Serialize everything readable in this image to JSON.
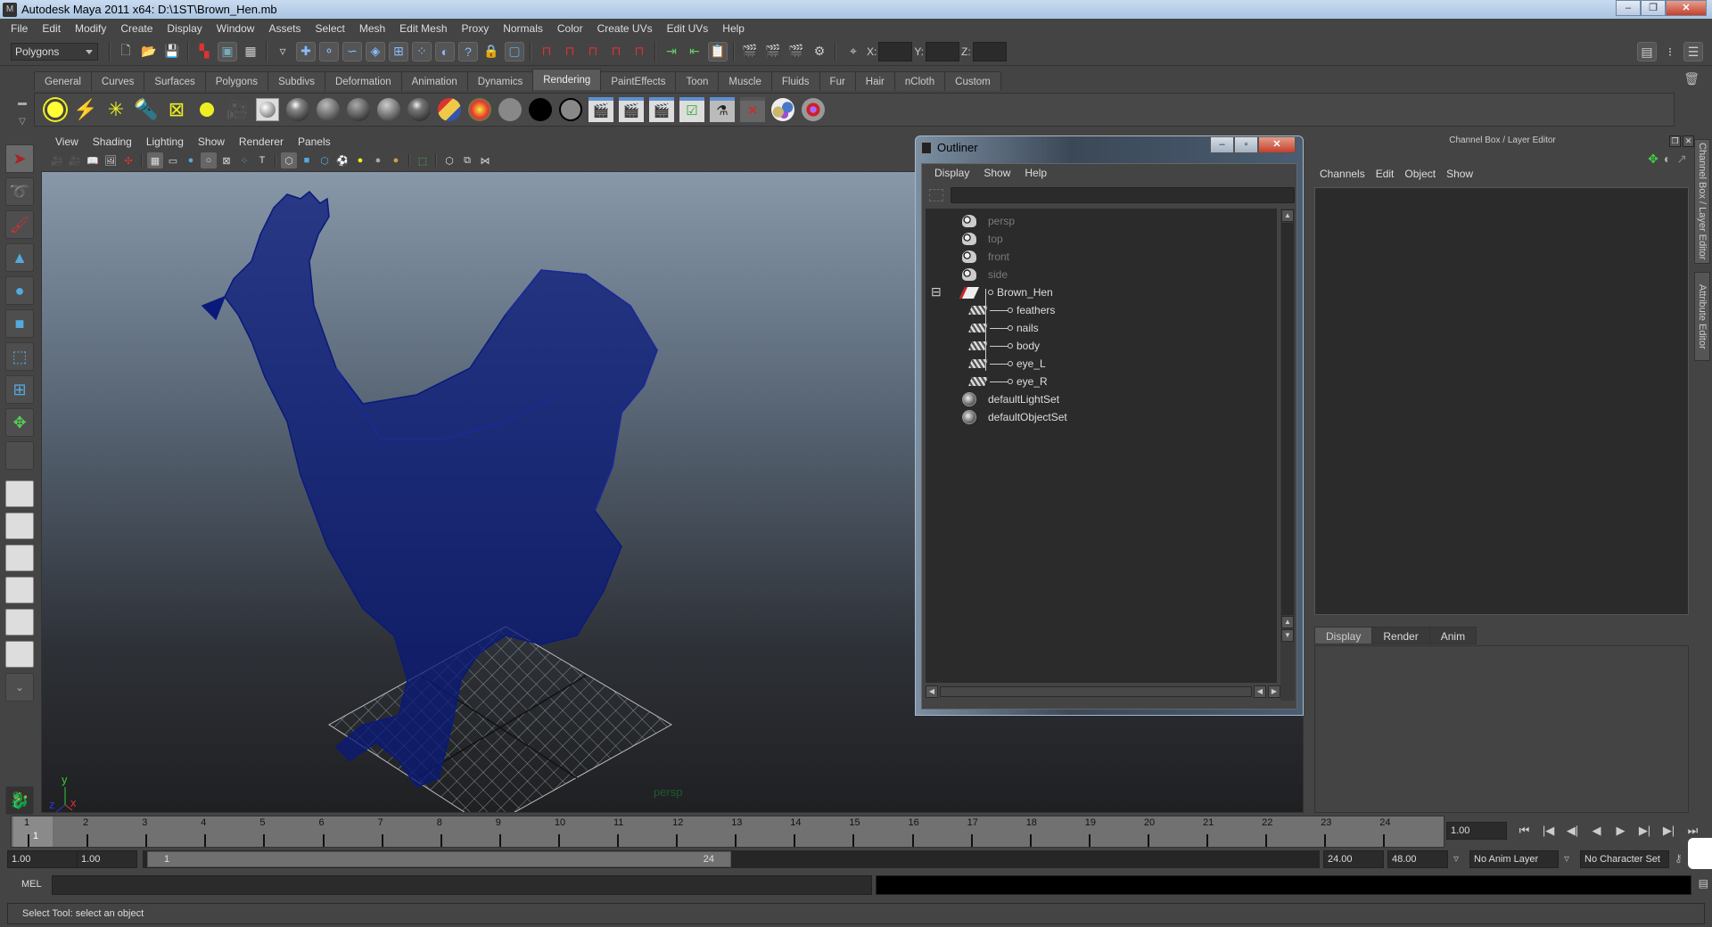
{
  "window": {
    "title": "Autodesk Maya 2011 x64: D:\\1ST\\Brown_Hen.mb",
    "controls": {
      "minimize": "–",
      "restore": "❐",
      "close": "✕"
    }
  },
  "menubar": [
    "File",
    "Edit",
    "Modify",
    "Create",
    "Display",
    "Window",
    "Assets",
    "Select",
    "Mesh",
    "Edit Mesh",
    "Proxy",
    "Normals",
    "Color",
    "Create UVs",
    "Edit UVs",
    "Help"
  ],
  "statusline": {
    "mode": "Polygons",
    "coord_labels": {
      "x": "X:",
      "y": "Y:",
      "z": "Z:"
    },
    "coord_values": {
      "x": "",
      "y": "",
      "z": ""
    }
  },
  "shelf": {
    "tabs": [
      "General",
      "Curves",
      "Surfaces",
      "Polygons",
      "Subdivs",
      "Deformation",
      "Animation",
      "Dynamics",
      "Rendering",
      "PaintEffects",
      "Toon",
      "Muscle",
      "Fluids",
      "Fur",
      "Hair",
      "nCloth",
      "Custom"
    ],
    "active_tab": "Rendering",
    "icons": [
      "ambient-light",
      "directional-light",
      "point-light",
      "spot-light",
      "area-light",
      "volume-light",
      "camera",
      "surface-shader",
      "blinn",
      "lambert",
      "phong",
      "phongE",
      "anisotropic",
      "ramp-shader",
      "layered-shader",
      "use-background",
      "black-shader",
      "gray-shader",
      "render-current-frame",
      "ipr-render",
      "batch-render",
      "render-settings",
      "hypershade",
      "delete-unused-nodes",
      "light-linking",
      "paint-effects-brush"
    ]
  },
  "toolbox": {
    "tools": [
      "select-tool",
      "lasso-tool",
      "paint-select-tool",
      "move-tool",
      "rotate-tool",
      "scale-tool",
      "manipulator-tool",
      "soft-mod-tool",
      "universal-manip",
      "last-tool"
    ],
    "layouts": [
      "single-pane",
      "four-pane",
      "outliner-persp",
      "persp-graph",
      "hypershade-persp",
      "persp-graph-hypershade"
    ],
    "more": "⌄"
  },
  "viewport": {
    "menu": [
      "View",
      "Shading",
      "Lighting",
      "Show",
      "Renderer",
      "Panels"
    ],
    "camera_label": "persp",
    "axis": {
      "x": "x",
      "y": "y",
      "z": "z"
    },
    "wire_color": "#0a1a7a"
  },
  "outliner": {
    "title": "Outliner",
    "menu": [
      "Display",
      "Show",
      "Help"
    ],
    "filter_value": "",
    "items": [
      {
        "label": "persp",
        "type": "camera",
        "depth": 0
      },
      {
        "label": "top",
        "type": "camera",
        "depth": 0
      },
      {
        "label": "front",
        "type": "camera",
        "depth": 0
      },
      {
        "label": "side",
        "type": "camera",
        "depth": 0
      },
      {
        "label": "Brown_Hen",
        "type": "transform",
        "depth": 0,
        "expanded": true
      },
      {
        "label": "feathers",
        "type": "mesh",
        "depth": 1
      },
      {
        "label": "nails",
        "type": "mesh",
        "depth": 1
      },
      {
        "label": "body",
        "type": "mesh",
        "depth": 1
      },
      {
        "label": "eye_L",
        "type": "mesh",
        "depth": 1
      },
      {
        "label": "eye_R",
        "type": "mesh",
        "depth": 1
      },
      {
        "label": "defaultLightSet",
        "type": "set",
        "depth": 0
      },
      {
        "label": "defaultObjectSet",
        "type": "set",
        "depth": 0
      }
    ],
    "expand_toggle": "⊟"
  },
  "channelbox": {
    "title": "Channel Box / Layer Editor",
    "menu": [
      "Channels",
      "Edit",
      "Object",
      "Show"
    ],
    "layer_tabs": [
      "Display",
      "Render",
      "Anim"
    ],
    "active_layer_tab": "Display",
    "side_tabs": [
      "Channel Box / Layer Editor",
      "Attribute Editor"
    ]
  },
  "timeline": {
    "start": 1,
    "end": 24,
    "current_frame_marker": "1",
    "current_frame": "1.00",
    "playback_buttons": [
      "⏮",
      "|◀",
      "◀|",
      "◀",
      "▶",
      "▶|",
      "▶|",
      "⏭"
    ]
  },
  "range": {
    "start_time": "1.00",
    "playback_start": "1.00",
    "slider_start_label": "1",
    "slider_end_label": "24",
    "playback_end": "24.00",
    "end_time": "48.00",
    "anim_layer": "No Anim Layer",
    "character_set": "No Character Set"
  },
  "commandline": {
    "label": "MEL",
    "input": "",
    "output": ""
  },
  "helpline": "Select Tool: select an object"
}
